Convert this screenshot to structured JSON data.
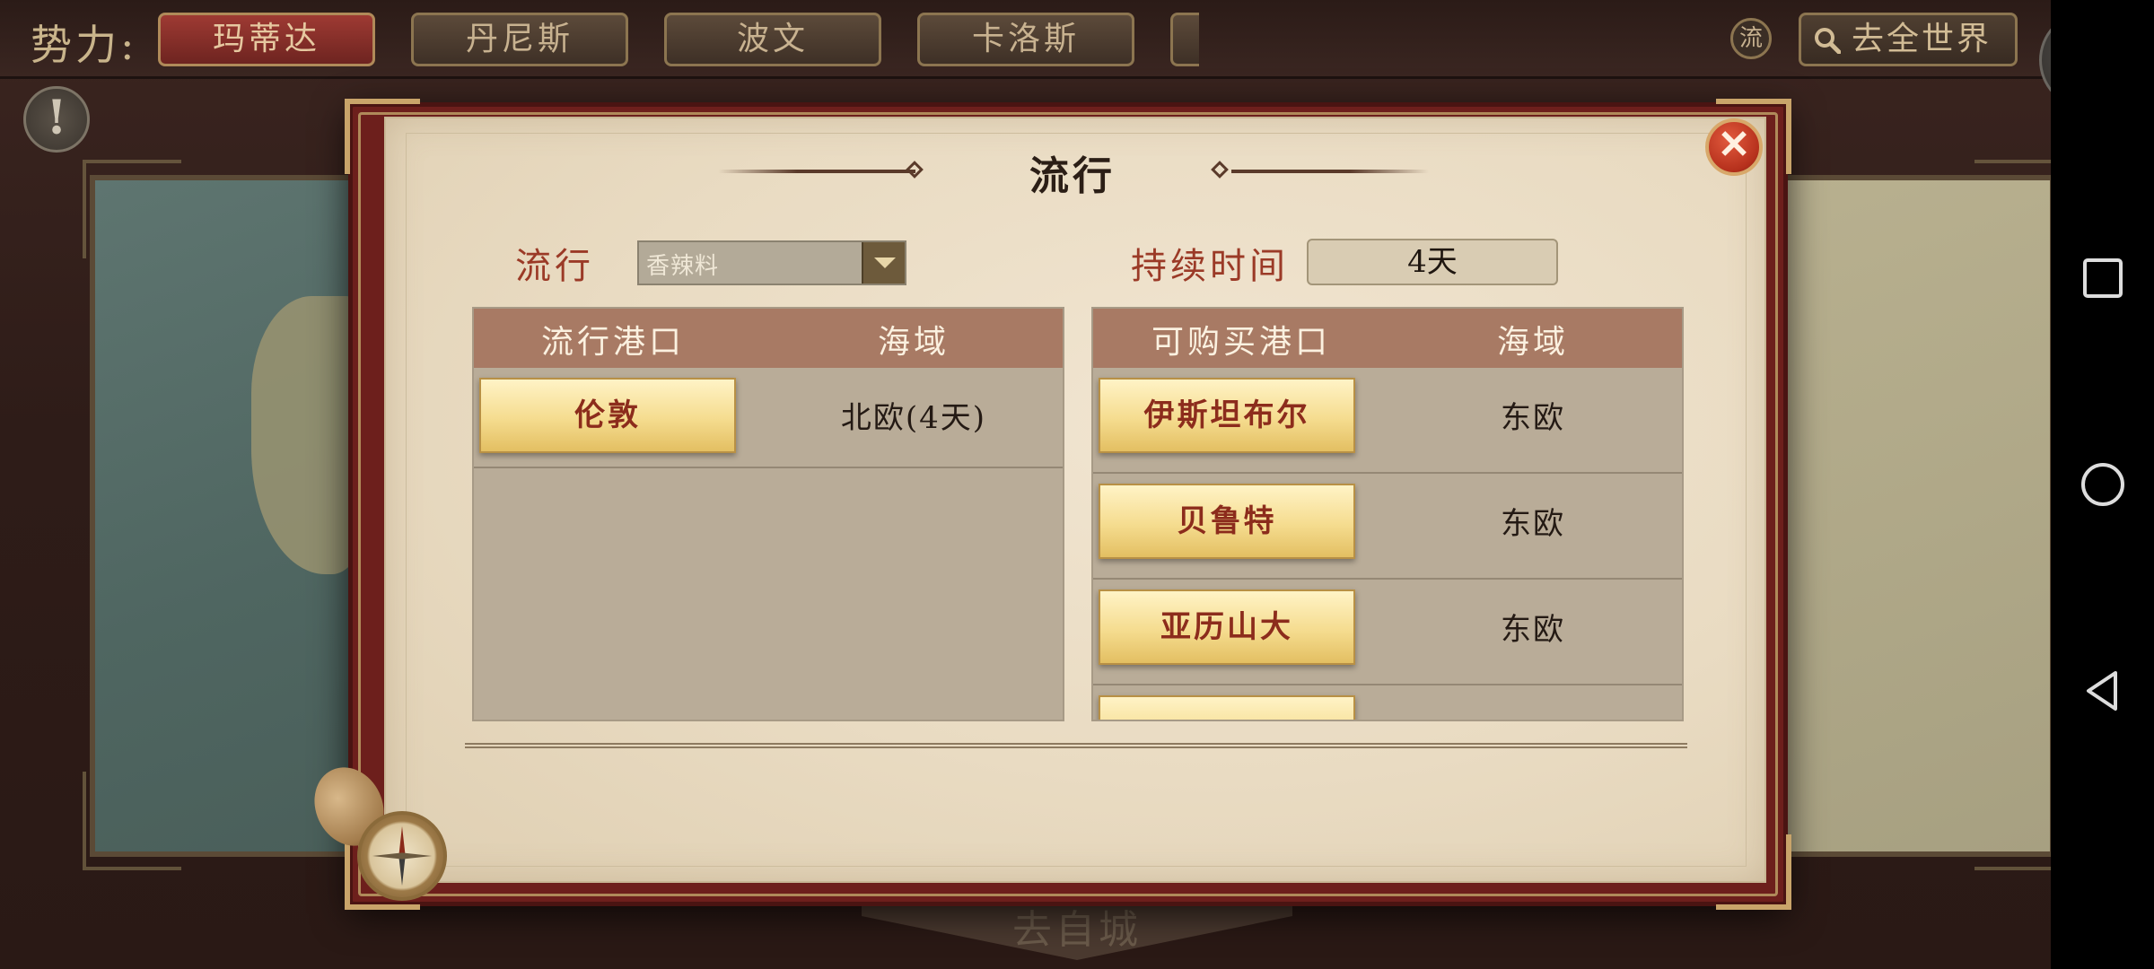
{
  "top_bar": {
    "faction_label": "势力:",
    "tabs": [
      {
        "label": "玛蒂达",
        "active": true
      },
      {
        "label": "丹尼斯",
        "active": false
      },
      {
        "label": "波文",
        "active": false
      },
      {
        "label": "卡洛斯",
        "active": false
      }
    ],
    "small_badge_label": "流",
    "world_button_label": "去全世界"
  },
  "background": {
    "bottom_banner_text": "去自城"
  },
  "dialog": {
    "title": "流行",
    "trend_label": "流行",
    "trend_select_value": "香辣料",
    "duration_label": "持续时间",
    "duration_value": "4天",
    "left_table": {
      "headers": [
        "流行港口",
        "海域"
      ],
      "rows": [
        {
          "port": "伦敦",
          "sea": "北欧(4天)"
        }
      ]
    },
    "right_table": {
      "headers": [
        "可购买港口",
        "海域"
      ],
      "rows": [
        {
          "port": "伊斯坦布尔",
          "sea": "东欧"
        },
        {
          "port": "贝鲁特",
          "sea": "东欧"
        },
        {
          "port": "亚历山大",
          "sea": "东欧"
        },
        {
          "port": "",
          "sea": ""
        }
      ]
    },
    "close_glyph": "✕"
  },
  "icons": {
    "alert": "!",
    "search": "search-icon",
    "back": "back-arrow-icon",
    "nav_recent": "square-icon",
    "nav_home": "circle-icon",
    "nav_back": "triangle-icon"
  },
  "colors": {
    "accent_red": "#9b3a27",
    "frame_red": "#6d1f1c",
    "gold_button": "#f5dc8f",
    "table_header": "#a87a64"
  }
}
